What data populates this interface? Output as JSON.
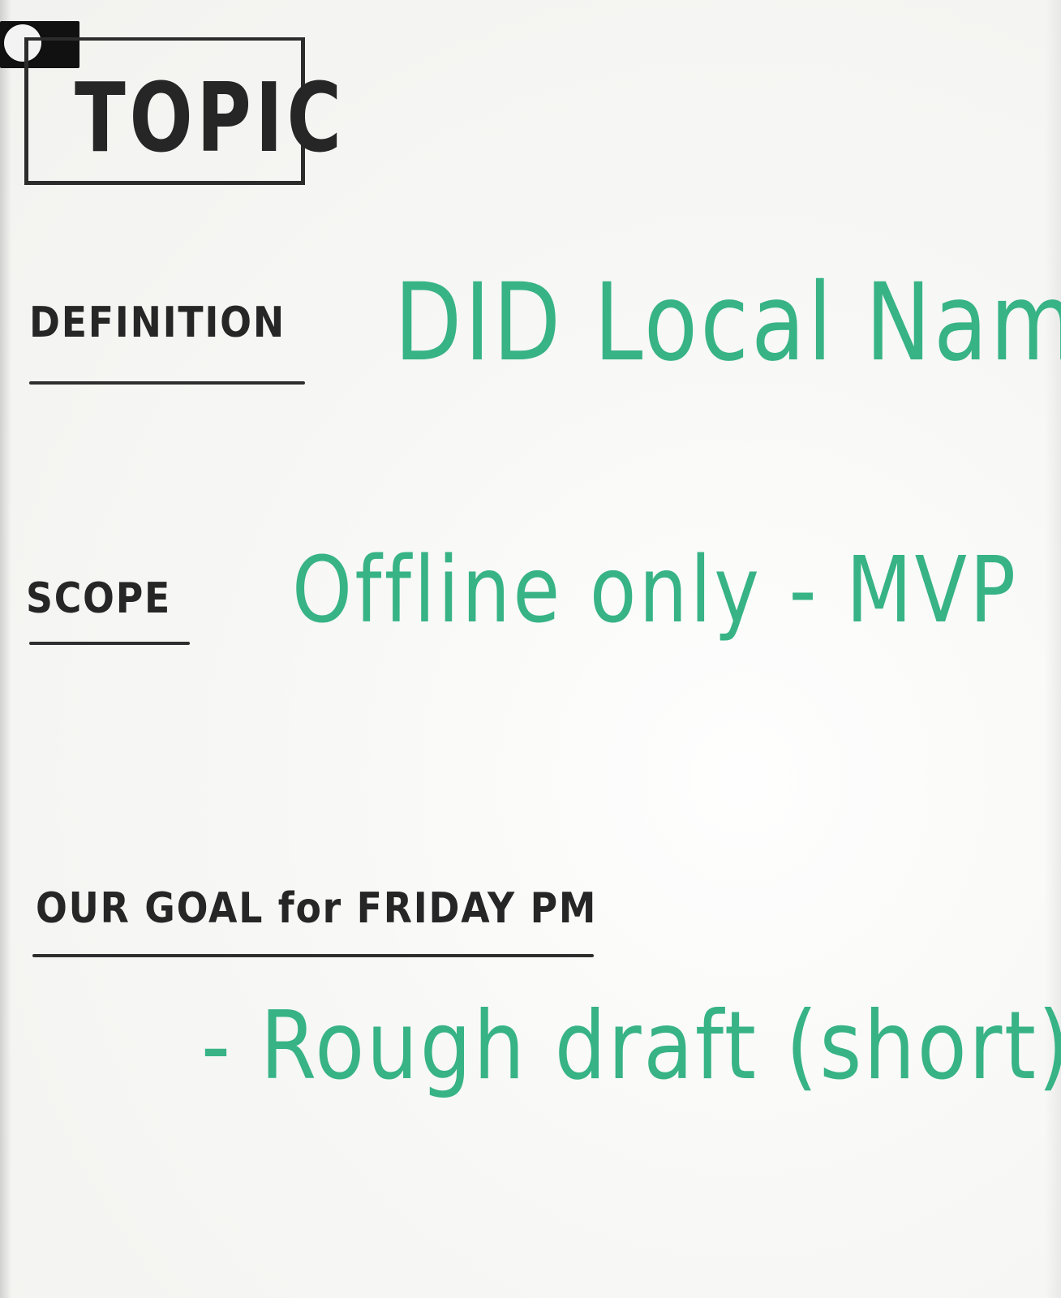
{
  "board": {
    "title": "TOPIC",
    "rows": [
      {
        "label": "DEFINITION",
        "value": "DID Local Names"
      },
      {
        "label": "SCOPE",
        "value": "Offline only - MVP"
      },
      {
        "label": "OUR GOAL for FRIDAY PM",
        "value": "- Rough draft (short)"
      }
    ]
  },
  "colors": {
    "black_marker": "#262626",
    "green_marker": "#37b386",
    "board": "#f6f6f4"
  }
}
